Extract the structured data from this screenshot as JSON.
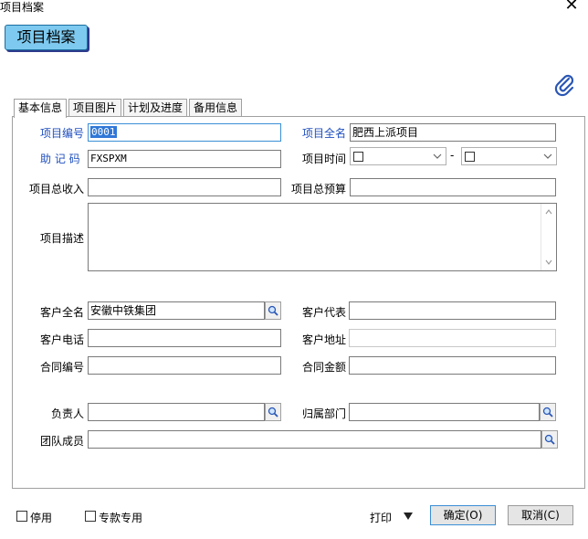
{
  "window": {
    "title": "项目档案"
  },
  "header": {
    "title": "项目档案"
  },
  "tabs": [
    {
      "label": "基本信息"
    },
    {
      "label": "项目图片"
    },
    {
      "label": "计划及进度"
    },
    {
      "label": "备用信息"
    }
  ],
  "form": {
    "project_code": {
      "label": "项目编号",
      "value": "0001"
    },
    "project_fullname": {
      "label": "项目全名",
      "value": "肥西上派项目"
    },
    "mnemonic": {
      "label": "助 记 码",
      "value": "FXSPXM"
    },
    "project_time": {
      "label": "项目时间",
      "separator": "-"
    },
    "total_income": {
      "label": "项目总收入",
      "value": ""
    },
    "total_budget": {
      "label": "项目总预算",
      "value": ""
    },
    "description": {
      "label": "项目描述",
      "value": ""
    },
    "customer_fullname": {
      "label": "客户全名",
      "value": "安徽中铁集团"
    },
    "customer_rep": {
      "label": "客户代表",
      "value": ""
    },
    "customer_phone": {
      "label": "客户电话",
      "value": ""
    },
    "customer_address": {
      "label": "客户地址",
      "value": ""
    },
    "contract_no": {
      "label": "合同编号",
      "value": ""
    },
    "contract_amount": {
      "label": "合同金额",
      "value": ""
    },
    "owner": {
      "label": "负责人",
      "value": ""
    },
    "department": {
      "label": "归属部门",
      "value": ""
    },
    "team_members": {
      "label": "团队成员",
      "value": ""
    }
  },
  "footer": {
    "disabled_label": "停用",
    "special_label": "专款专用",
    "print_label": "打印",
    "ok_label": "确定(O)",
    "cancel_label": "取消(C)"
  }
}
